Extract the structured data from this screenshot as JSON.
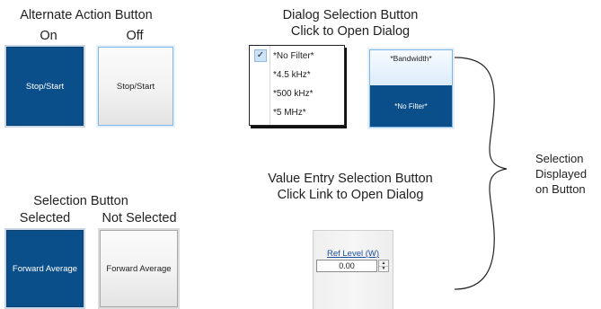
{
  "alternate_action": {
    "title": "Alternate Action Button",
    "on_label": "On",
    "off_label": "Off",
    "on_button": "Stop/Start",
    "off_button": "Stop/Start"
  },
  "dialog_selection": {
    "title_line1": "Dialog Selection Button",
    "title_line2": "Click to Open Dialog",
    "menu_check": "✓",
    "menu_items": [
      "*No Filter*",
      "*4.5 kHz*",
      "*500 kHz*",
      "*5 MHz*"
    ],
    "button_top": "*Bandwidth*",
    "button_bottom": "*No Filter*"
  },
  "selection_displayed": {
    "line1": "Selection",
    "line2": "Displayed",
    "line3": "on Button"
  },
  "selection_button": {
    "title": "Selection Button",
    "selected_label": "Selected",
    "not_selected_label": "Not Selected",
    "selected_button": "Forward Average",
    "not_selected_button": "Forward Average"
  },
  "value_entry": {
    "title_line1": "Value Entry Selection Button",
    "title_line2": "Click Link to Open Dialog",
    "link": "Ref Level (W)",
    "value": "0.00",
    "spin_up": "▲",
    "spin_down": "▼"
  },
  "colors": {
    "selected_fill": "#0b4f8a",
    "highlight_edge": "#7fb6e6",
    "link": "#1f4f9a"
  }
}
